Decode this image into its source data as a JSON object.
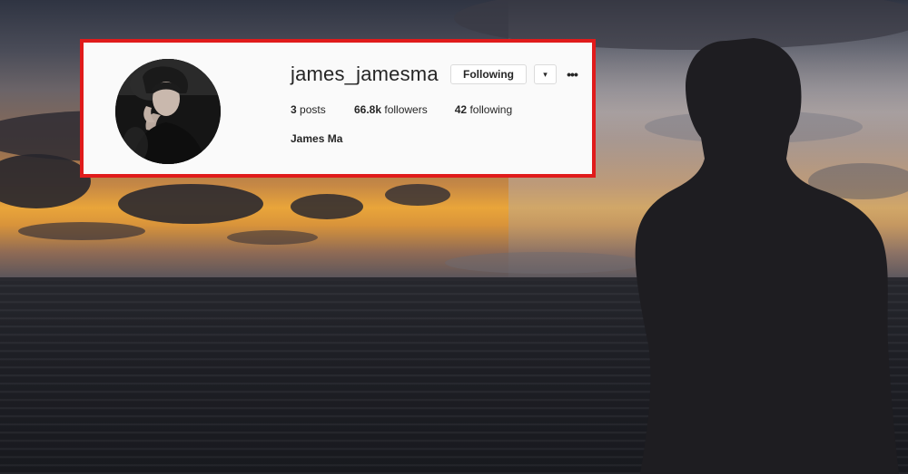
{
  "profile": {
    "username": "james_jamesma",
    "following_button": "Following",
    "dropdown_glyph": "▾",
    "more_glyph": "•••",
    "stats": {
      "posts_count": "3",
      "posts_label": "posts",
      "followers_count": "66.8k",
      "followers_label": "followers",
      "following_count": "42",
      "following_label": "following"
    },
    "full_name": "James Ma"
  },
  "colors": {
    "highlight_border": "#e01b1b",
    "card_background": "#fafafa",
    "text": "#262626"
  },
  "icons": {
    "dropdown": "chevron-down-icon",
    "more": "more-options-icon"
  }
}
